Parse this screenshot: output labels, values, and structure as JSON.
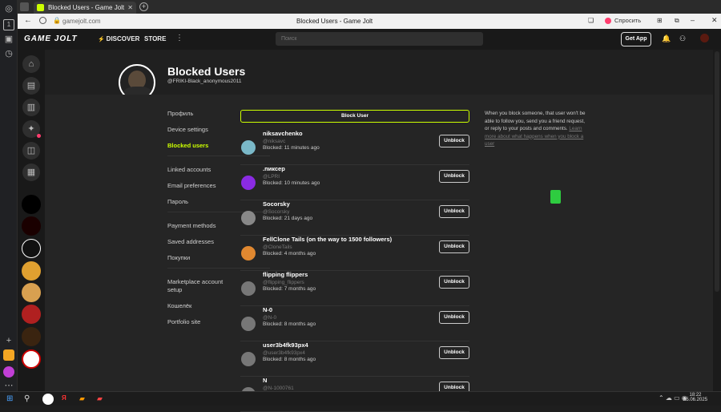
{
  "browser": {
    "tab_title": "Blocked Users - Game Jolt",
    "url": "gamejolt.com",
    "page_title": "Blocked Users - Game Jolt",
    "ask_label": "Спросить",
    "rail_tab_count": "1"
  },
  "nav": {
    "logo": "GAME JOLT",
    "discover": "DISCOVER",
    "store": "STORE",
    "search_placeholder": "Поиск",
    "get_app": "Get App"
  },
  "header": {
    "title": "Blocked Users",
    "handle": "@FRIKI-Black_anonymous2011"
  },
  "menu": {
    "groups": [
      [
        "Профиль",
        "Device settings",
        "Blocked users"
      ],
      [
        "Linked accounts",
        "Email preferences",
        "Пароль"
      ],
      [
        "Payment methods",
        "Saved addresses",
        "Покупки"
      ],
      [
        "Marketplace account setup",
        "Кошелёк",
        "Portfolio site"
      ]
    ]
  },
  "block_user_label": "Block User",
  "unblock_label": "Unblock",
  "blocked_users": [
    {
      "name": "niksavchenko",
      "handle": "@niksavc",
      "when": "Blocked: 11 minutes ago"
    },
    {
      "name": ".пиксер",
      "handle": "@LPRI",
      "when": "Blocked: 10 minutes ago"
    },
    {
      "name": "Socorsky",
      "handle": "@Socorsky",
      "when": "Blocked: 21 days ago"
    },
    {
      "name": "FellClone Tails (on the way to 1500 followers)",
      "handle": "@CloneTails",
      "when": "Blocked: 4 months ago"
    },
    {
      "name": "flipping flippers",
      "handle": "@flipping_flippers",
      "when": "Blocked: 7 months ago"
    },
    {
      "name": "N-0",
      "handle": "@N-0",
      "when": "Blocked: 8 months ago"
    },
    {
      "name": "user3b4fk93px4",
      "handle": "@user3b4fk93px4",
      "when": "Blocked: 8 months ago"
    },
    {
      "name": "N",
      "handle": "@N-1000761",
      "when": ""
    }
  ],
  "help": {
    "text": "When you block someone, that user won't be able to follow you, send you a friend request, or reply to your posts and comments.",
    "link": "Learn more about what happens when you block a user"
  },
  "taskbar": {
    "time": "18:22",
    "date": "05.06.2025"
  },
  "colors": {
    "accent": "#ccff00",
    "background": "#252525",
    "header": "#202020"
  }
}
